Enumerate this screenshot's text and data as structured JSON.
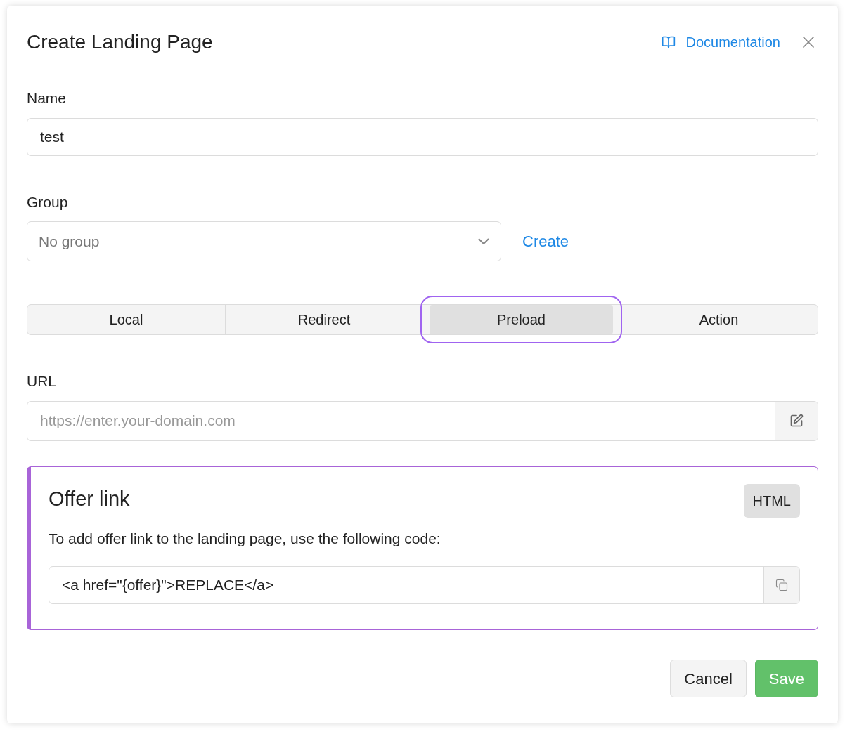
{
  "dialog": {
    "title": "Create Landing Page",
    "doc_link": "Documentation"
  },
  "name_field": {
    "label": "Name",
    "value": "test"
  },
  "group_field": {
    "label": "Group",
    "value": "No group",
    "create_link": "Create"
  },
  "tabs": [
    {
      "label": "Local",
      "selected": false
    },
    {
      "label": "Redirect",
      "selected": false
    },
    {
      "label": "Preload",
      "selected": true
    },
    {
      "label": "Action",
      "selected": false
    }
  ],
  "url_field": {
    "label": "URL",
    "placeholder": "https://enter.your-domain.com"
  },
  "offer_panel": {
    "title": "Offer link",
    "badge": "HTML",
    "description": "To add offer link to the landing page, use the following code:",
    "code": "<a href=\"{offer}\">REPLACE</a>"
  },
  "buttons": [
    {
      "label": "Cancel",
      "kind": "secondary"
    },
    {
      "label": "Save",
      "kind": "primary"
    }
  ]
}
